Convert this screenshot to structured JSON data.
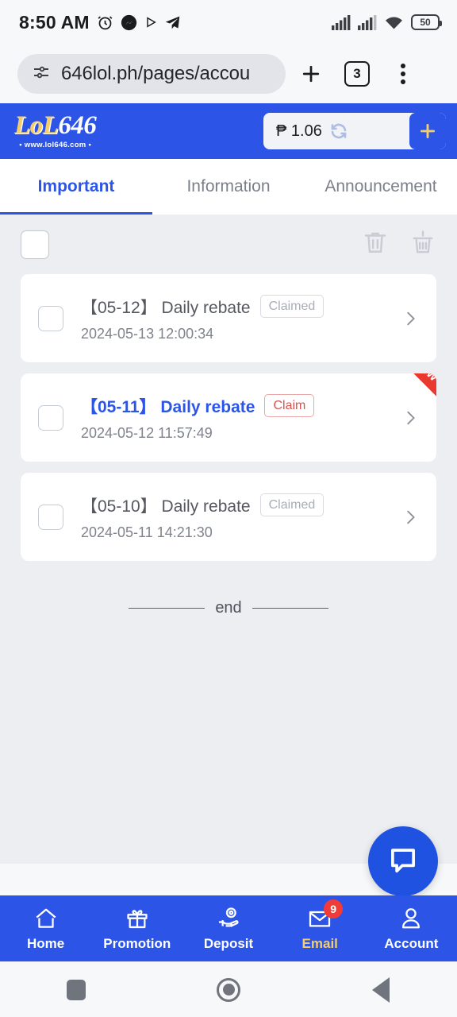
{
  "status_bar": {
    "time": "8:50 AM",
    "icons": [
      "alarm-icon",
      "messenger-icon",
      "play-icon",
      "telegram-icon"
    ],
    "signal_icons": [
      "signal-bars-icon",
      "signal-bars-icon",
      "wifi-icon"
    ],
    "battery_level": "50"
  },
  "browser": {
    "url": "646lol.ph/pages/accou",
    "page_info_icon": "page-info-icon",
    "new_tab_label": "+",
    "tab_count": "3",
    "menu_icon": "more-vertical-icon"
  },
  "site_header": {
    "logo_primary": "LoL",
    "logo_secondary": "646",
    "logo_subtitle": "• www.lol646.com •",
    "balance": "₱ 1.06",
    "refresh_icon": "refresh-icon",
    "deposit_label": "+",
    "brand_color": "#2c55e8",
    "accent_gold": "#f3ce6a"
  },
  "tabs": [
    {
      "label": "Important",
      "active": true
    },
    {
      "label": "Information",
      "active": false
    },
    {
      "label": "Announcement",
      "active": false
    }
  ],
  "toolbar": {
    "select_all_label": "",
    "delete_icon": "trash-icon",
    "clear_icon": "broom-icon"
  },
  "messages": [
    {
      "title": "【05-12】 Daily rebate",
      "badge": "Claimed",
      "badge_state": "claimed",
      "date": "2024-05-13 12:00:34",
      "unread": false,
      "ribbon": ""
    },
    {
      "title": "【05-11】 Daily rebate",
      "badge": "Claim",
      "badge_state": "claim",
      "date": "2024-05-12 11:57:49",
      "unread": true,
      "ribbon": "NEW"
    },
    {
      "title": "【05-10】 Daily rebate",
      "badge": "Claimed",
      "badge_state": "claimed",
      "date": "2024-05-11 14:21:30",
      "unread": false,
      "ribbon": ""
    }
  ],
  "list_end": {
    "label": "end"
  },
  "fab": {
    "icon": "chat-bubble-icon"
  },
  "bottom_nav": [
    {
      "label": "Home",
      "icon": "home-icon",
      "active": false,
      "badge": ""
    },
    {
      "label": "Promotion",
      "icon": "gift-icon",
      "active": false,
      "badge": ""
    },
    {
      "label": "Deposit",
      "icon": "hand-coin-icon",
      "active": false,
      "badge": ""
    },
    {
      "label": "Email",
      "icon": "envelope-icon",
      "active": true,
      "badge": "9"
    },
    {
      "label": "Account",
      "icon": "user-icon",
      "active": false,
      "badge": ""
    }
  ],
  "android_nav": [
    {
      "name": "recents-button",
      "icon": "square-icon"
    },
    {
      "name": "home-button",
      "icon": "circle-icon"
    },
    {
      "name": "back-button",
      "icon": "triangle-left-icon"
    }
  ]
}
